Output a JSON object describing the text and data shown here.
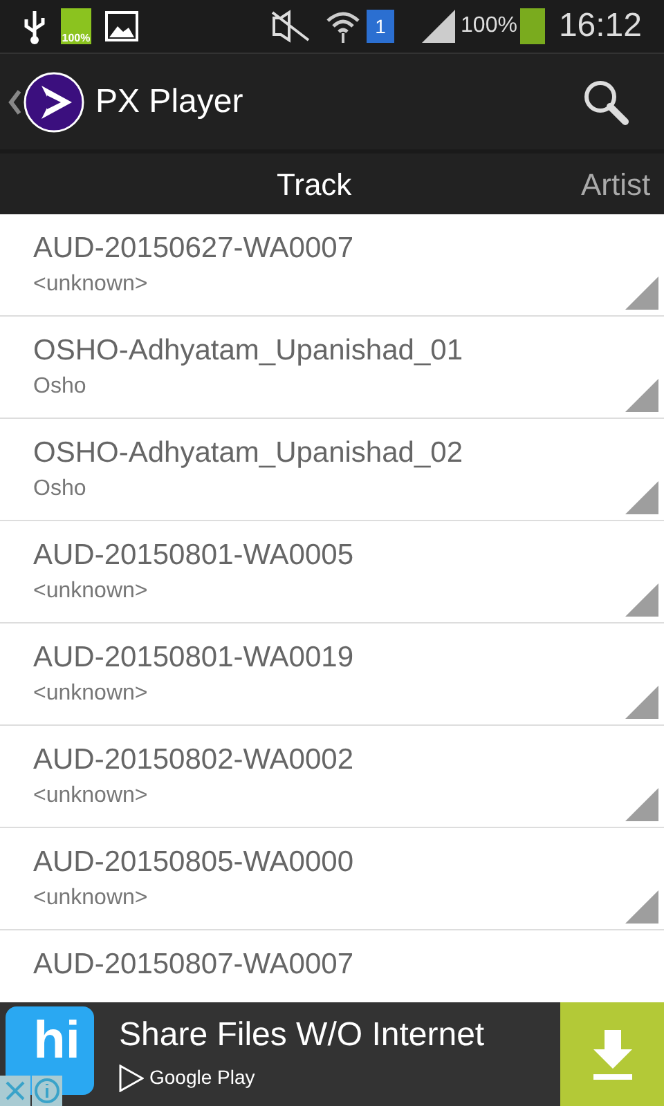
{
  "status_bar": {
    "battery_icon_label": "100%",
    "sim_label": "1",
    "battery_percent": "100%",
    "time": "16:12"
  },
  "app_bar": {
    "title": "PX Player"
  },
  "tabs": [
    {
      "label": "Track",
      "selected": true
    },
    {
      "label": "Artist",
      "selected": false
    }
  ],
  "tracks": [
    {
      "title": "AUD-20150627-WA0007",
      "artist": "<unknown>"
    },
    {
      "title": "OSHO-Adhyatam_Upanishad_01",
      "artist": "Osho"
    },
    {
      "title": "OSHO-Adhyatam_Upanishad_02",
      "artist": "Osho"
    },
    {
      "title": "AUD-20150801-WA0005",
      "artist": "<unknown>"
    },
    {
      "title": "AUD-20150801-WA0019",
      "artist": "<unknown>"
    },
    {
      "title": "AUD-20150802-WA0002",
      "artist": "<unknown>"
    },
    {
      "title": "AUD-20150805-WA0000",
      "artist": "<unknown>"
    },
    {
      "title": "AUD-20150807-WA0007"
    }
  ],
  "ad": {
    "logo_text": "hi",
    "headline": "Share Files W/O Internet",
    "store": "Google Play"
  }
}
